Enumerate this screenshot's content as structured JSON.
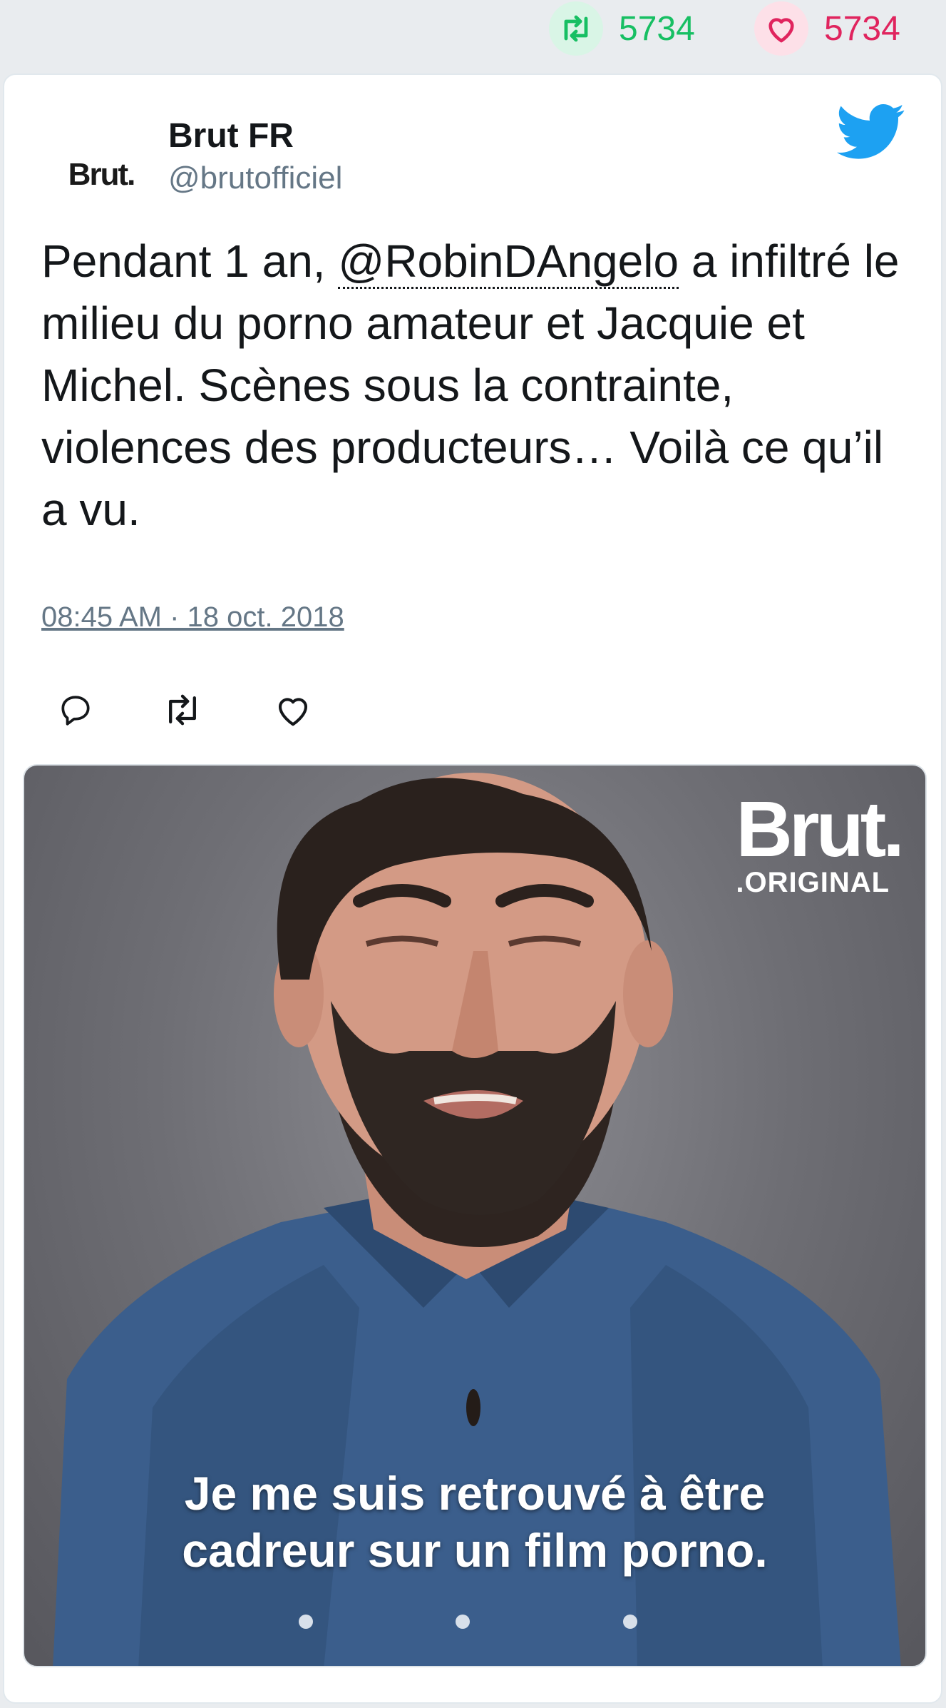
{
  "stats": {
    "retweets": "5734",
    "likes": "5734"
  },
  "tweet": {
    "author_name": "Brut FR",
    "author_handle": "@brutofficiel",
    "avatar_text": "Brut.",
    "text_before": "Pendant 1 an, ",
    "mention": "@RobinDAngelo",
    "text_after": " a infiltré le milieu du porno amateur et Jacquie et Michel. Scènes sous la contrainte, violences des producteurs… Voilà ce qu’il a vu.",
    "timestamp": "08:45 AM · 18 oct. 2018"
  },
  "media": {
    "logo_word": "Brut.",
    "logo_sub": ".ORIGINAL",
    "caption_line1": "Je me suis retrouvé à être",
    "caption_line2": "cadreur sur un film porno."
  },
  "colors": {
    "retweet": "#17bf63",
    "like": "#e0245e",
    "twitter_blue": "#1da1f2",
    "secondary_text": "#657786"
  },
  "icons": [
    "retweet-icon",
    "heart-icon",
    "twitter-bird-icon",
    "reply-icon"
  ]
}
